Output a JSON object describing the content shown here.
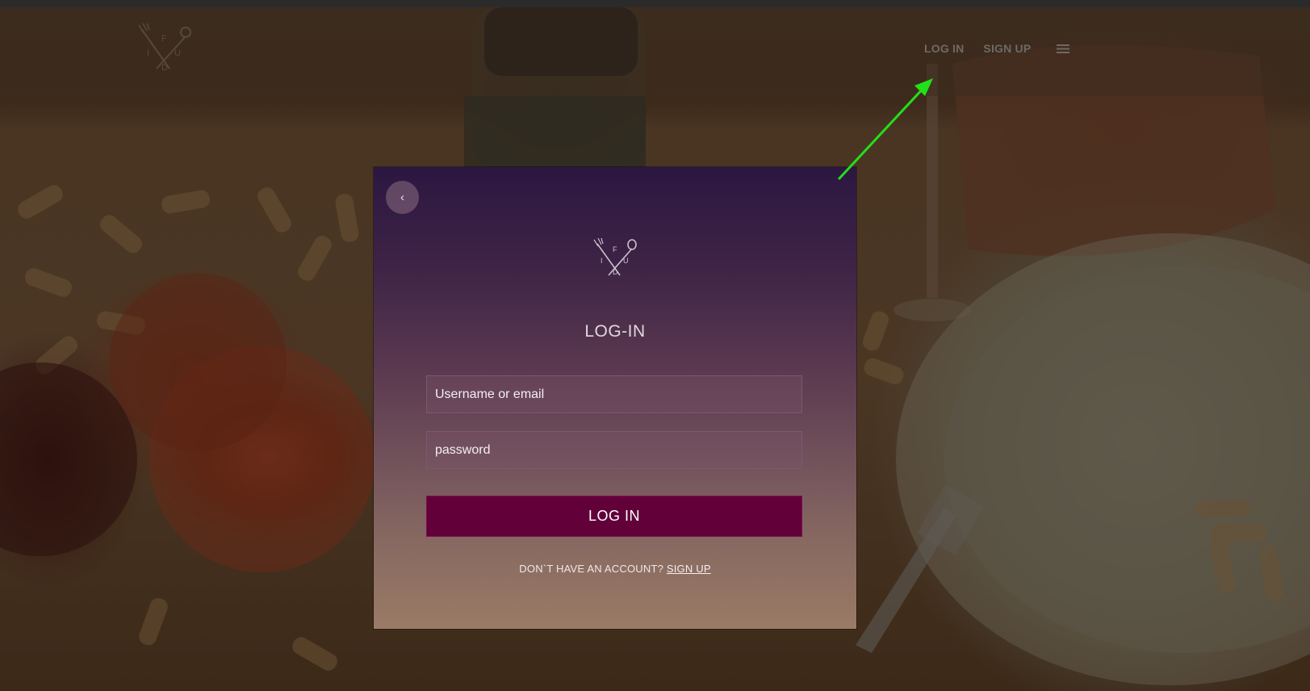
{
  "header": {
    "logo_letters": [
      "F",
      "I",
      "U",
      "D"
    ],
    "nav": {
      "login_label": "LOG IN",
      "signup_label": "SIGN UP"
    },
    "menu_icon": "hamburger-menu-icon"
  },
  "modal": {
    "back_label": "‹",
    "logo_letters": [
      "F",
      "I",
      "U",
      "D"
    ],
    "title": "LOG-IN",
    "username": {
      "value": "",
      "placeholder": "Username or email"
    },
    "password": {
      "value": "",
      "placeholder": "password"
    },
    "submit_label": "LOG IN",
    "no_account_text": "DON`T HAVE AN ACCOUNT?",
    "signup_link_label": "SIGN UP"
  },
  "colors": {
    "button_bg": "#62003a",
    "annotation_arrow": "#22e01a",
    "modal_top": "#2c1741",
    "modal_bottom": "#9a7b66"
  }
}
